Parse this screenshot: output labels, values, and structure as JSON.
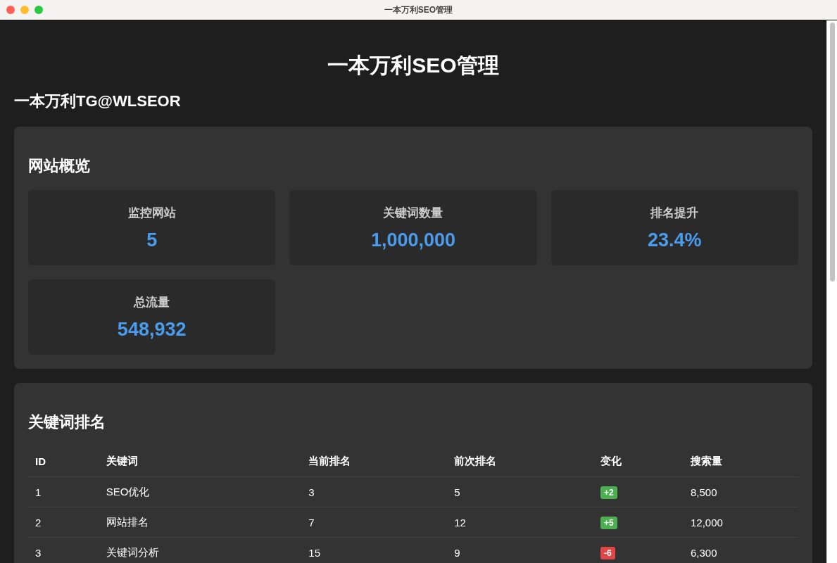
{
  "window": {
    "title": "一本万利SEO管理"
  },
  "heading": "一本万利SEO管理",
  "subheading": "一本万利TG@WLSEOR",
  "overview": {
    "title": "网站概览",
    "stats": [
      {
        "label": "监控网站",
        "value": "5"
      },
      {
        "label": "关键词数量",
        "value": "1,000,000"
      },
      {
        "label": "排名提升",
        "value": "23.4%"
      },
      {
        "label": "总流量",
        "value": "548,932"
      }
    ]
  },
  "rankings": {
    "title": "关键词排名",
    "columns": [
      "ID",
      "关键词",
      "当前排名",
      "前次排名",
      "变化",
      "搜索量"
    ],
    "rows": [
      {
        "id": "1",
        "keyword": "SEO优化",
        "current": "3",
        "previous": "5",
        "change": {
          "text": "+2",
          "kind": "up"
        },
        "volume": "8,500"
      },
      {
        "id": "2",
        "keyword": "网站排名",
        "current": "7",
        "previous": "12",
        "change": {
          "text": "+5",
          "kind": "up"
        },
        "volume": "12,000"
      },
      {
        "id": "3",
        "keyword": "关键词分析",
        "current": "15",
        "previous": "9",
        "change": {
          "text": "-6",
          "kind": "down"
        },
        "volume": "6,300"
      }
    ]
  }
}
